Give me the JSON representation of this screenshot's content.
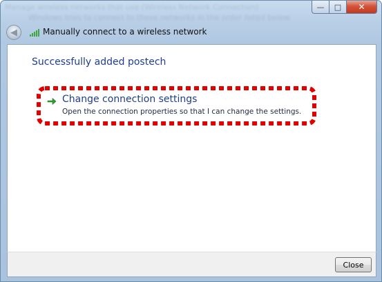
{
  "window": {
    "title": "Manually connect to a wireless network",
    "controls": {
      "minimize": "—",
      "maximize": "□",
      "close": "✕"
    }
  },
  "background_text": [
    "Manage wireless networks that use (Wireless Network Connection)",
    "Windows tries to connect to these networks in the order listed below."
  ],
  "content": {
    "heading": "Successfully added postech",
    "command_link": {
      "title": "Change connection settings",
      "description": "Open the connection properties so that I can change the settings."
    }
  },
  "footer": {
    "close_label": "Close"
  },
  "colors": {
    "link_blue": "#1e3d8c",
    "arrow_green": "#2f9e33",
    "highlight_red": "#e00000"
  },
  "icons": [
    "back-arrow-icon",
    "wireless-signal-icon",
    "green-arrow-icon"
  ]
}
